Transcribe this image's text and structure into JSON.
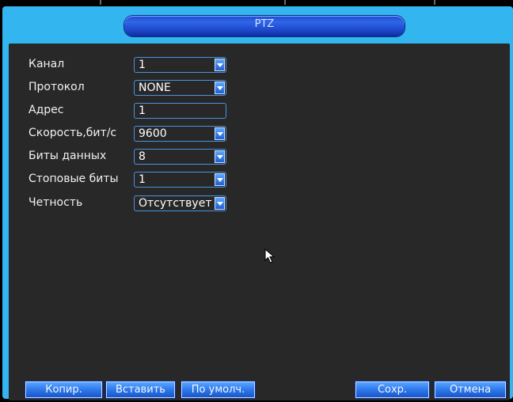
{
  "window": {
    "title": "PTZ"
  },
  "form": {
    "rows": [
      {
        "label": "Канал",
        "value": "1",
        "dropdown": true
      },
      {
        "label": "Протокол",
        "value": "NONE",
        "dropdown": true
      },
      {
        "label": "Адрес",
        "value": "1",
        "dropdown": false
      },
      {
        "label": "Скорость,бит/с",
        "value": "9600",
        "dropdown": true
      },
      {
        "label": "Биты данных",
        "value": "8",
        "dropdown": true
      },
      {
        "label": "Стоповые биты",
        "value": "1",
        "dropdown": true
      },
      {
        "label": "Четность",
        "value": "Отсутствует",
        "dropdown": true
      }
    ]
  },
  "buttons": {
    "copy": "Копир.",
    "paste": "Вставить",
    "default": "По умолч.",
    "save": "Сохр.",
    "cancel": "Отмена"
  },
  "colors": {
    "frame": "#33b6f0",
    "panel": "#282828",
    "button": "#2d78ec",
    "field_border": "#4a93e0"
  },
  "icons": {
    "cursor": "mouse-pointer-icon",
    "dropdown": "chevron-down-icon"
  }
}
